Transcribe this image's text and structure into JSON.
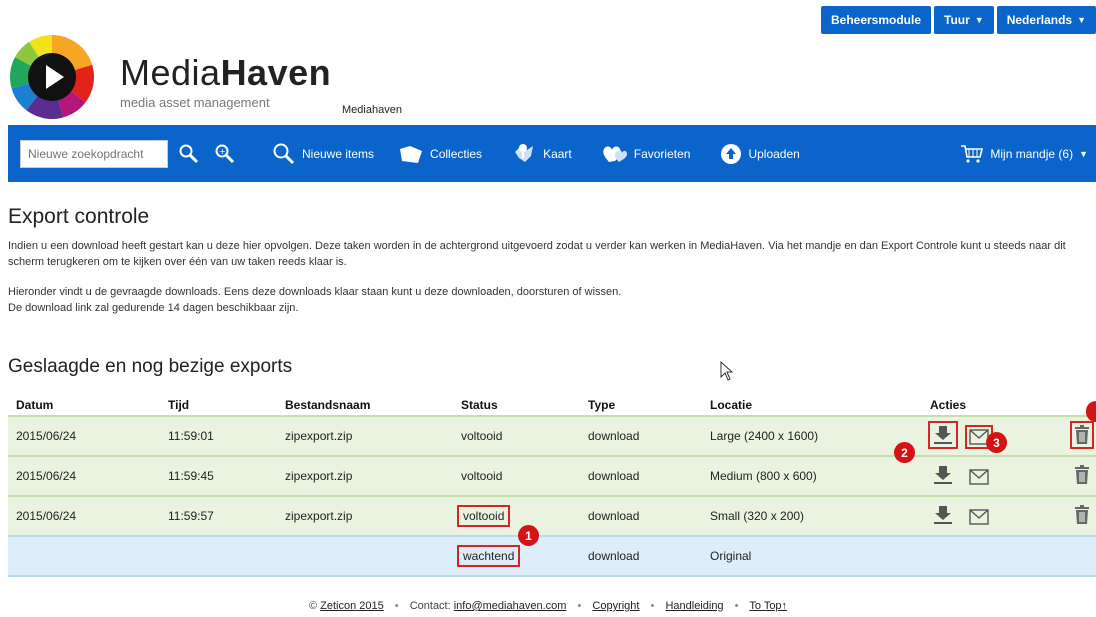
{
  "topbar": {
    "admin_label": "Beheersmodule",
    "user_label": "Tuur",
    "language_label": "Nederlands"
  },
  "header": {
    "brand_light": "Media",
    "brand_bold": "Haven",
    "tagline": "media asset management",
    "sub_brand": "Mediahaven"
  },
  "nav": {
    "search_placeholder": "Nieuwe zoekopdracht",
    "new_items": "Nieuwe items",
    "collections": "Collecties",
    "map": "Kaart",
    "favorites": "Favorieten",
    "upload": "Uploaden",
    "cart": "Mijn mandje (6)"
  },
  "main": {
    "title": "Export controle",
    "intro1": "Indien u een download heeft gestart kan u deze hier opvolgen. Deze taken worden in de achtergrond uitgevoerd zodat u verder kan werken in MediaHaven. Via het mandje en dan Export Controle kunt u steeds naar dit scherm terugkeren om te kijken over één van uw taken reeds klaar is.",
    "intro2": "Hieronder vindt u de gevraagde downloads. Eens deze downloads klaar staan kunt u deze downloaden, doorsturen of wissen.",
    "intro3": "De download link zal gedurende 14 dagen beschikbaar zijn.",
    "section_title": "Geslaagde en nog bezige exports"
  },
  "table": {
    "headers": [
      "Datum",
      "Tijd",
      "Bestandsnaam",
      "Status",
      "Type",
      "Locatie",
      "Acties"
    ],
    "rows": [
      {
        "date": "2015/06/24",
        "time": "11:59:01",
        "file": "zipexport.zip",
        "status": "voltooid",
        "type": "download",
        "location": "Large (2400 x 1600)"
      },
      {
        "date": "2015/06/24",
        "time": "11:59:45",
        "file": "zipexport.zip",
        "status": "voltooid",
        "type": "download",
        "location": "Medium (800 x 600)"
      },
      {
        "date": "2015/06/24",
        "time": "11:59:57",
        "file": "zipexport.zip",
        "status": "voltooid",
        "type": "download",
        "location": "Small (320 x 200)"
      },
      {
        "date": "",
        "time": "",
        "file": "",
        "status": "wachtend",
        "type": "download",
        "location": "Original"
      }
    ]
  },
  "annotations": {
    "one": "1",
    "two": "2",
    "three": "3"
  },
  "footer": {
    "company_prefix": "© ",
    "company": "Zeticon 2015",
    "contact_label": "Contact: ",
    "email": "info@mediahaven.com",
    "copyright": "Copyright",
    "manual": "Handleiding",
    "to_top": "To Top↑"
  },
  "colors": {
    "brand_blue": "#0a64c9",
    "row_done": "#e9f3df",
    "row_pending": "#ddeefa",
    "highlight_red": "#d41414"
  },
  "icons": [
    "search-icon",
    "advanced-search-icon",
    "magnifier-icon",
    "folder-icon",
    "map-pin-icon",
    "heart-icon",
    "upload-icon",
    "cart-icon",
    "download-icon",
    "mail-icon",
    "trash-icon"
  ]
}
